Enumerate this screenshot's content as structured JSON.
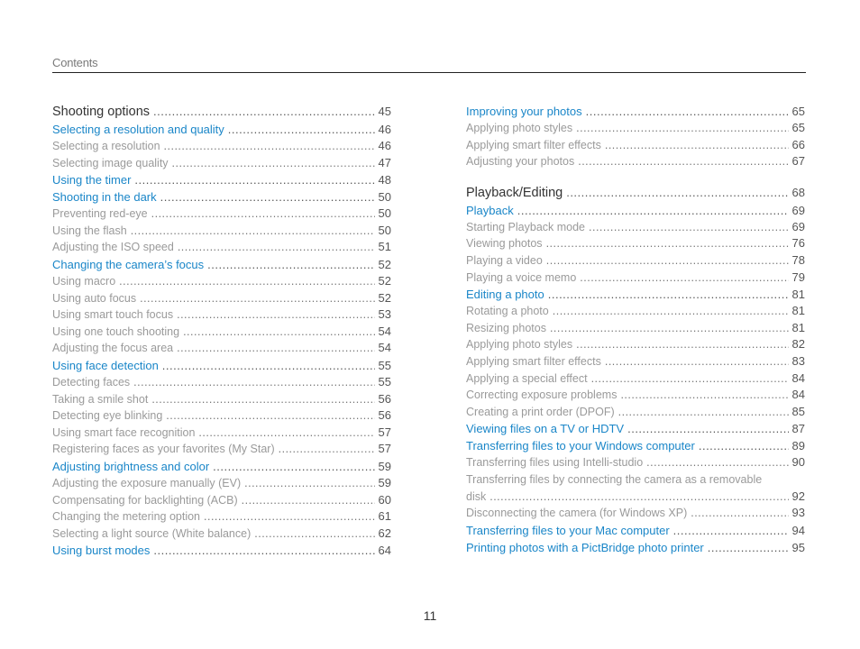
{
  "header": {
    "title": "Contents"
  },
  "page_number": "11",
  "left_column": [
    {
      "level": 1,
      "label": "Shooting options",
      "page": "45"
    },
    {
      "level": 2,
      "label": "Selecting a resolution and quality",
      "page": "46"
    },
    {
      "level": 3,
      "label": "Selecting a resolution",
      "page": "46"
    },
    {
      "level": 3,
      "label": "Selecting image quality",
      "page": "47"
    },
    {
      "level": 2,
      "label": "Using the timer",
      "page": "48"
    },
    {
      "level": 2,
      "label": "Shooting in the dark",
      "page": "50"
    },
    {
      "level": 3,
      "label": "Preventing red-eye",
      "page": "50"
    },
    {
      "level": 3,
      "label": "Using the flash",
      "page": "50"
    },
    {
      "level": 3,
      "label": "Adjusting the ISO speed",
      "page": "51"
    },
    {
      "level": 2,
      "label": "Changing the camera’s focus",
      "page": "52"
    },
    {
      "level": 3,
      "label": "Using macro",
      "page": "52"
    },
    {
      "level": 3,
      "label": "Using auto focus",
      "page": "52"
    },
    {
      "level": 3,
      "label": "Using smart touch focus",
      "page": "53"
    },
    {
      "level": 3,
      "label": "Using one touch shooting",
      "page": "54"
    },
    {
      "level": 3,
      "label": "Adjusting the focus area",
      "page": "54"
    },
    {
      "level": 2,
      "label": "Using face detection",
      "page": "55"
    },
    {
      "level": 3,
      "label": "Detecting faces",
      "page": "55"
    },
    {
      "level": 3,
      "label": "Taking a smile shot",
      "page": "56"
    },
    {
      "level": 3,
      "label": "Detecting eye blinking",
      "page": "56"
    },
    {
      "level": 3,
      "label": "Using smart face recognition",
      "page": "57"
    },
    {
      "level": 3,
      "label": "Registering faces as your favorites (My Star)",
      "page": "57"
    },
    {
      "level": 2,
      "label": "Adjusting brightness and color",
      "page": "59"
    },
    {
      "level": 3,
      "label": "Adjusting the exposure manually (EV)",
      "page": "59"
    },
    {
      "level": 3,
      "label": "Compensating for backlighting (ACB)",
      "page": "60"
    },
    {
      "level": 3,
      "label": "Changing the metering option",
      "page": "61"
    },
    {
      "level": 3,
      "label": "Selecting a light source (White balance)",
      "page": "62"
    },
    {
      "level": 2,
      "label": "Using burst modes",
      "page": "64"
    }
  ],
  "right_column": [
    {
      "level": 2,
      "label": "Improving your photos",
      "page": "65"
    },
    {
      "level": 3,
      "label": "Applying photo styles",
      "page": "65"
    },
    {
      "level": 3,
      "label": "Applying smart filter effects",
      "page": "66"
    },
    {
      "level": 3,
      "label": "Adjusting your photos",
      "page": "67"
    },
    {
      "level": 0,
      "label": "",
      "page": ""
    },
    {
      "level": 1,
      "label": "Playback/Editing",
      "page": "68"
    },
    {
      "level": 2,
      "label": "Playback",
      "page": "69"
    },
    {
      "level": 3,
      "label": "Starting Playback mode",
      "page": "69"
    },
    {
      "level": 3,
      "label": "Viewing photos",
      "page": "76"
    },
    {
      "level": 3,
      "label": "Playing a video",
      "page": "78"
    },
    {
      "level": 3,
      "label": "Playing a voice memo",
      "page": "79"
    },
    {
      "level": 2,
      "label": "Editing a photo",
      "page": "81"
    },
    {
      "level": 3,
      "label": "Rotating a photo",
      "page": "81"
    },
    {
      "level": 3,
      "label": "Resizing photos",
      "page": "81"
    },
    {
      "level": 3,
      "label": "Applying photo styles",
      "page": "82"
    },
    {
      "level": 3,
      "label": "Applying smart filter effects",
      "page": "83"
    },
    {
      "level": 3,
      "label": "Applying a special effect",
      "page": "84"
    },
    {
      "level": 3,
      "label": "Correcting exposure problems",
      "page": "84"
    },
    {
      "level": 3,
      "label": "Creating a print order (DPOF)",
      "page": "85"
    },
    {
      "level": 2,
      "label": "Viewing files on a TV or HDTV",
      "page": "87"
    },
    {
      "level": 2,
      "label": "Transferring files to your Windows computer",
      "page": "89"
    },
    {
      "level": 3,
      "label": "Transferring files using Intelli-studio",
      "page": "90"
    },
    {
      "level": 4,
      "label": "Transferring files by connecting the camera as a removable",
      "page": ""
    },
    {
      "level": 3,
      "label": "disk",
      "page": "92"
    },
    {
      "level": 3,
      "label": "Disconnecting the camera (for Windows XP)",
      "page": "93"
    },
    {
      "level": 2,
      "label": "Transferring files to your Mac computer",
      "page": "94"
    },
    {
      "level": 2,
      "label": "Printing photos with a PictBridge photo printer",
      "page": "95"
    }
  ]
}
